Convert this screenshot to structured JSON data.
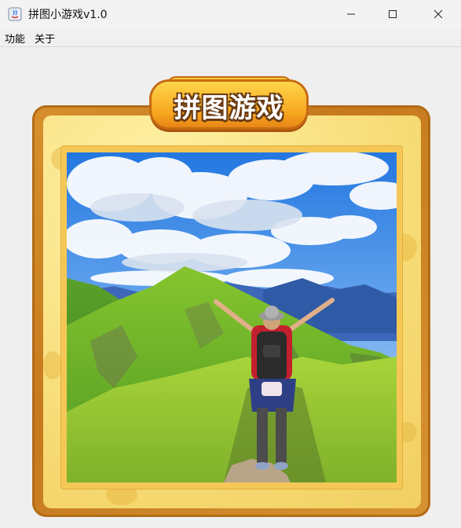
{
  "window": {
    "title": "拼图小游戏v1.0",
    "controls": {
      "minimize_icon": "minimize-icon",
      "maximize_icon": "maximize-icon",
      "close_icon": "close-icon"
    }
  },
  "menubar": {
    "items": [
      {
        "label": "功能"
      },
      {
        "label": "关于"
      }
    ]
  },
  "game": {
    "title_badge": "拼图游戏",
    "puzzle_image": "hiker-on-mountain-ridge"
  },
  "colors": {
    "frame_brown": "#c57a1d",
    "frame_yellow": "#f7dc77",
    "badge_orange": "#f7a51f",
    "sky_blue": "#2f86e6",
    "grass_green": "#6db32a"
  }
}
